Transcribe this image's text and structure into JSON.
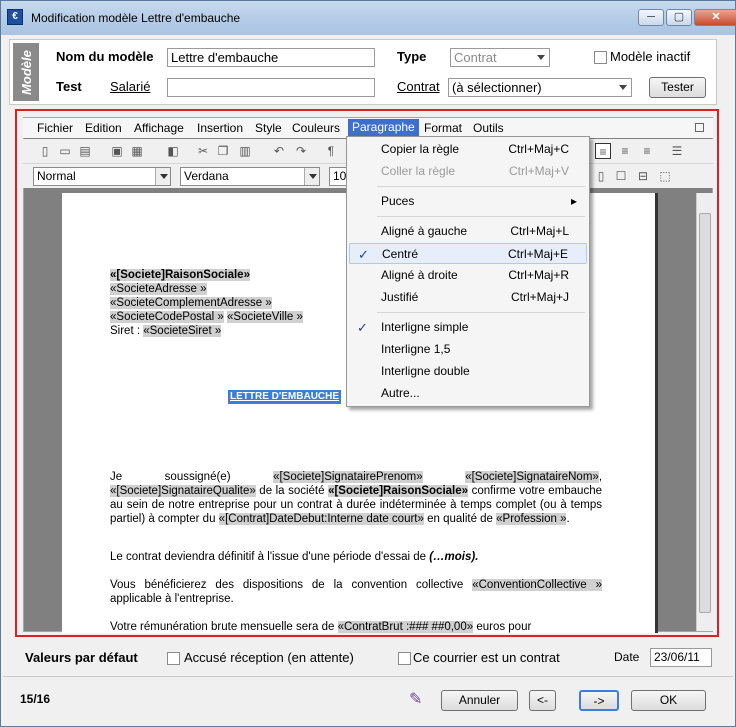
{
  "window": {
    "title": "Modification modèle Lettre d'embauche",
    "min": "─",
    "max": "▢",
    "close": "✕"
  },
  "header": {
    "section_label": "Modèle",
    "nom_label": "Nom du modèle",
    "nom_value": "Lettre d'embauche",
    "type_label": "Type",
    "type_value": "Contrat",
    "inactif_label": "Modèle inactif",
    "test_label": "Test",
    "salarie_link": "Salarié",
    "salarie_value": "",
    "contrat_link": "Contrat",
    "contrat_value": "(à sélectionner)",
    "tester_button": "Tester"
  },
  "editor": {
    "menu": [
      "Fichier",
      "Edition",
      "Affichage",
      "Insertion",
      "Style",
      "Couleurs",
      "Paragraphe",
      "Format",
      "Outils"
    ],
    "style_value": "Normal",
    "font_value": "Verdana",
    "size_value": "10"
  },
  "document": {
    "l1": "«[Societe]RaisonSociale»",
    "l2": "«SocieteAdresse »",
    "l3": "«SocieteComplementAdresse »",
    "l4a": "«SocieteCodePostal »",
    "l4b": "«SocieteVille »",
    "l5a": "Siret : ",
    "l5b": "«SocieteSiret »",
    "heading": "LETTRE D'EMBAUCHE",
    "p1_a": "Je soussigné(e) ",
    "p1_f1": "«[Societe]SignatairePrenom»",
    "p1_f2": "«[Societe]SignataireNom»",
    "p1_b": ",",
    "p1_f3": "«[Societe]SignataireQualite»",
    "p1_c": " de la société ",
    "p1_f4": "«[Societe]RaisonSociale»",
    "p1_d": " confirme votre embauche au sein de notre entreprise pour un contrat à durée indéterminée à temps complet (ou à temps partiel) à compter du ",
    "p1_f5": "«[Contrat]DateDebut:Interne date court»",
    "p1_e": " en qualité de ",
    "p1_f6": "«Profession »",
    "p1_g": ".",
    "p2_a": "Le contrat deviendra définitif à l'issue d'une période d'essai de ",
    "p2_b": "(…mois).",
    "p3_a": "Vous bénéficierez des dispositions de la convention collective ",
    "p3_f": "«ConventionCollective »",
    "p3_b": " applicable à l'entreprise.",
    "p4_a": "Votre rémunération brute mensuelle sera de ",
    "p4_f": "«ContratBrut :### ##0,00»",
    "p4_b": " euros pour"
  },
  "paragraph_menu": [
    {
      "label": "Copier la règle",
      "shortcut": "Ctrl+Maj+C"
    },
    {
      "label": "Coller la règle",
      "shortcut": "Ctrl+Maj+V"
    },
    {
      "label": "Puces",
      "shortcut": "▸"
    },
    {
      "label": "Aligné à gauche",
      "shortcut": "Ctrl+Maj+L"
    },
    {
      "label": "Centré",
      "shortcut": "Ctrl+Maj+E"
    },
    {
      "label": "Aligné à droite",
      "shortcut": "Ctrl+Maj+R"
    },
    {
      "label": "Justifié",
      "shortcut": "Ctrl+Maj+J"
    },
    {
      "label": "Interligne simple",
      "shortcut": ""
    },
    {
      "label": "Interligne 1,5",
      "shortcut": ""
    },
    {
      "label": "Interligne double",
      "shortcut": ""
    },
    {
      "label": "Autre...",
      "shortcut": ""
    }
  ],
  "footer": {
    "defaults_label": "Valeurs par défaut",
    "accuse_label": "Accusé réception (en attente)",
    "contrat_label": "Ce courrier est un contrat",
    "date_label": "Date",
    "date_value": "23/06/11",
    "page_counter": "15/16",
    "annuler": "Annuler",
    "prev": "<-",
    "next": "->",
    "ok": "OK"
  }
}
